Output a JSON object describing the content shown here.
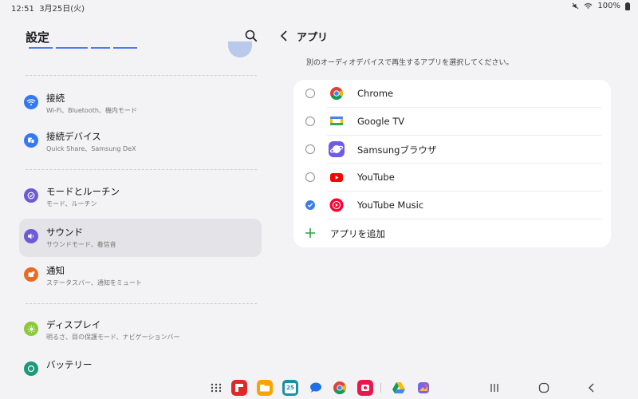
{
  "status_bar": {
    "time": "12:51",
    "date": "3月25日(火)",
    "battery": "100%"
  },
  "left_pane": {
    "title": "設定",
    "items": [
      {
        "title": "接続",
        "subtitle": "Wi-Fi、Bluetooth、機内モード",
        "icon": "wifi-icon",
        "color": "#3478f6"
      },
      {
        "title": "接続デバイス",
        "subtitle": "Quick Share、Samsung DeX",
        "icon": "devices-icon",
        "color": "#3478f6"
      },
      {
        "title": "モードとルーチン",
        "subtitle": "モード、ルーチン",
        "icon": "check-circle-icon",
        "color": "#6b5bd6"
      },
      {
        "title": "サウンド",
        "subtitle": "サウンドモード、着信音",
        "icon": "volume-icon",
        "color": "#6b5bd6"
      },
      {
        "title": "通知",
        "subtitle": "ステータスバー、通知をミュート",
        "icon": "notification-icon",
        "color": "#ea6a24"
      },
      {
        "title": "ディスプレイ",
        "subtitle": "明るさ、目の保護モード、ナビゲーションバー",
        "icon": "brightness-icon",
        "color": "#8bc93a"
      },
      {
        "title": "バッテリー",
        "subtitle": "",
        "icon": "battery-icon",
        "color": "#1a9a7a"
      }
    ],
    "selected_index": 3
  },
  "right_pane": {
    "title": "アプリ",
    "description": "別のオーディオデバイスで再生するアプリを選択してください。",
    "apps": [
      {
        "name": "Chrome",
        "icon": "chrome-icon",
        "checked": false
      },
      {
        "name": "Google TV",
        "icon": "google-tv-icon",
        "checked": false
      },
      {
        "name": "Samsungブラウザ",
        "icon": "samsung-browser-icon",
        "checked": false
      },
      {
        "name": "YouTube",
        "icon": "youtube-icon",
        "checked": false
      },
      {
        "name": "YouTube Music",
        "icon": "youtube-music-icon",
        "checked": true
      }
    ],
    "add_label": "アプリを追加"
  },
  "taskbar": {
    "apps": [
      "app-drawer-icon",
      "flipboard-icon",
      "files-icon",
      "calendar-icon",
      "messages-icon",
      "chrome-icon",
      "screen-recorder-icon",
      "drive-icon",
      "photos-icon"
    ],
    "calendar_day": "25"
  },
  "colors": {
    "accent": "#3b7de8",
    "add_green": "#2e9f4a",
    "selected_bg": "#e4e4e8"
  }
}
